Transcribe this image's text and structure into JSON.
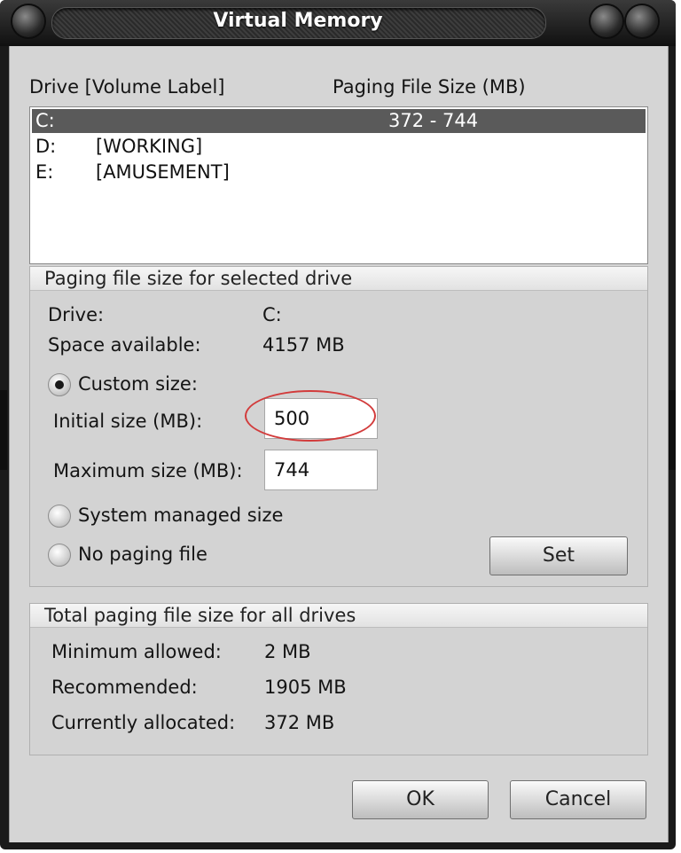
{
  "window": {
    "title": "Virtual Memory"
  },
  "drive_list": {
    "header_drive": "Drive  [Volume Label]",
    "header_size": "Paging File Size (MB)",
    "rows": [
      {
        "drive": "C:",
        "label": "",
        "size": "372 - 744",
        "selected": true
      },
      {
        "drive": "D:",
        "label": "[WORKING]",
        "size": "",
        "selected": false
      },
      {
        "drive": "E:",
        "label": "[AMUSEMENT]",
        "size": "",
        "selected": false
      }
    ]
  },
  "selected_drive": {
    "group_title": "Paging file size for selected drive",
    "drive_label": "Drive:",
    "drive_value": "C:",
    "space_label": "Space available:",
    "space_value": "4157 MB",
    "custom_size_label": "Custom size:",
    "initial_label": "Initial size (MB):",
    "initial_value": "500",
    "max_label": "Maximum size (MB):",
    "max_value": "744",
    "system_managed_label": "System managed size",
    "no_paging_label": "No paging file",
    "set_button": "Set",
    "selected_option": "custom"
  },
  "totals": {
    "group_title": "Total paging file size for all drives",
    "min_label": "Minimum allowed:",
    "min_value": "2 MB",
    "recommended_label": "Recommended:",
    "recommended_value": "1905 MB",
    "allocated_label": "Currently allocated:",
    "allocated_value": "372 MB"
  },
  "footer": {
    "ok_button": "OK",
    "cancel_button": "Cancel"
  },
  "colors": {
    "annotation_ring": "#d23b3b",
    "selection": "#5a5a5a"
  }
}
